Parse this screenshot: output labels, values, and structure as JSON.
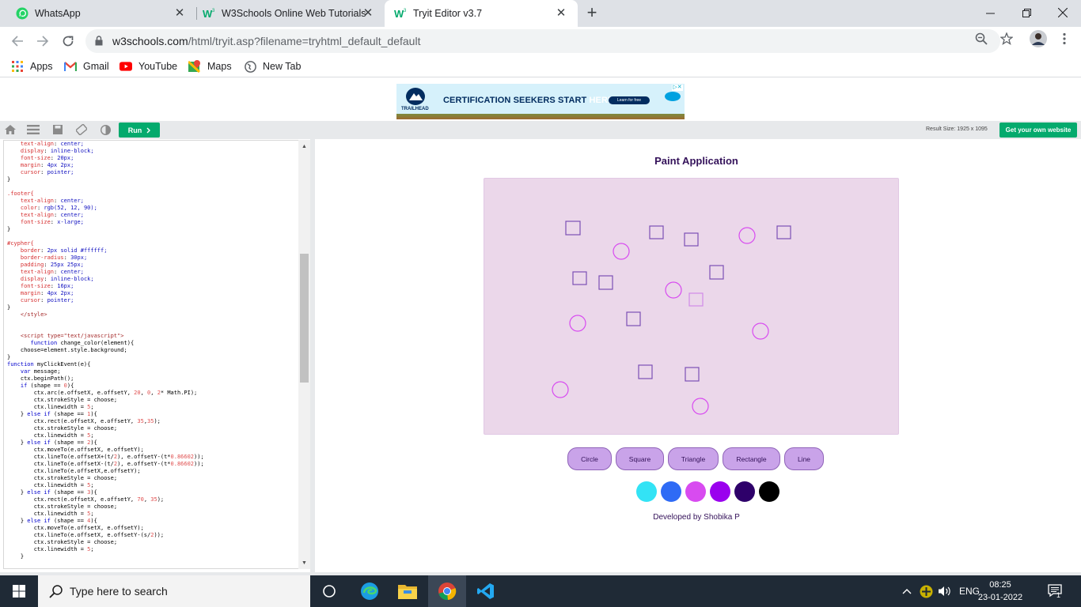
{
  "browser": {
    "tabs": [
      {
        "title": "WhatsApp",
        "icon": "whatsapp-icon",
        "active": false
      },
      {
        "title": "W3Schools Online Web Tutorials",
        "icon": "w3schools-icon",
        "active": false
      },
      {
        "title": "Tryit Editor v3.7",
        "icon": "w3schools-icon",
        "active": true
      }
    ],
    "url_host": "w3schools.com",
    "url_path": "/html/tryit.asp?filename=tryhtml_default_default",
    "bookmarks": [
      {
        "label": "Apps",
        "icon": "apps-grid-icon"
      },
      {
        "label": "Gmail",
        "icon": "gmail-icon"
      },
      {
        "label": "YouTube",
        "icon": "youtube-icon"
      },
      {
        "label": "Maps",
        "icon": "maps-icon"
      },
      {
        "label": "New Tab",
        "icon": "globe-icon"
      }
    ]
  },
  "ad": {
    "text_main": "CERTIFICATION SEEKERS START",
    "text_accent": "HERE.",
    "button": "Learn for free",
    "brand": "TRAILHEAD"
  },
  "tryit": {
    "run_label": "Run",
    "result_size": "Result Size: 1925 x 1095",
    "own_site_label": "Get your own website"
  },
  "code_lines": [
    {
      "pre": "    ",
      "prop": "text-align",
      "val": "center;"
    },
    {
      "pre": "    ",
      "prop": "display",
      "val": "inline-block;"
    },
    {
      "pre": "    ",
      "prop": "font-size",
      "val": "20px;"
    },
    {
      "pre": "    ",
      "prop": "margin",
      "val": "4px 2px;"
    },
    {
      "pre": "    ",
      "prop": "cursor",
      "val": "pointer;"
    },
    {
      "raw": "}"
    },
    {
      "raw": ""
    },
    {
      "sel": ".footer{"
    },
    {
      "pre": "    ",
      "prop": "text-align",
      "val": "center;"
    },
    {
      "pre": "    ",
      "prop": "color",
      "val": "rgb(52, 12, 90);"
    },
    {
      "pre": "    ",
      "prop": "text-align",
      "val": "center;"
    },
    {
      "pre": "    ",
      "prop": "font-size",
      "val": "x-large;"
    },
    {
      "raw": "}"
    },
    {
      "raw": ""
    },
    {
      "sel": "#cypher{"
    },
    {
      "pre": "    ",
      "prop": "border",
      "val": "2px solid #ffffff;"
    },
    {
      "pre": "    ",
      "prop": "border-radius",
      "val": "30px;"
    },
    {
      "pre": "    ",
      "prop": "padding",
      "val": "25px 25px;"
    },
    {
      "pre": "    ",
      "prop": "text-align",
      "val": "center;"
    },
    {
      "pre": "    ",
      "prop": "display",
      "val": "inline-block;"
    },
    {
      "pre": "    ",
      "prop": "font-size",
      "val": "16px;"
    },
    {
      "pre": "    ",
      "prop": "margin",
      "val": "4px 2px;"
    },
    {
      "pre": "    ",
      "prop": "cursor",
      "val": "pointer;"
    },
    {
      "raw": "}"
    },
    {
      "tag": "    </style>"
    },
    {
      "raw": ""
    },
    {
      "raw": ""
    },
    {
      "tag": "    <script type=\"text/javascript\">"
    },
    {
      "code": "       function change_color(element){"
    },
    {
      "code": "    choose=element.style.background;"
    },
    {
      "raw": "}"
    },
    {
      "code": "function myClickEvent(e){"
    },
    {
      "code": "    var message;"
    },
    {
      "code": "    ctx.beginPath();"
    },
    {
      "code": "    if (shape == 0){"
    },
    {
      "code": "        ctx.arc(e.offsetX, e.offsetY, 20, 0, 2* Math.PI);"
    },
    {
      "code": "        ctx.strokeStyle = choose;"
    },
    {
      "code": "        ctx.linewidth = 5;"
    },
    {
      "code": "    } else if (shape == 1){"
    },
    {
      "code": "        ctx.rect(e.offsetX, e.offsetY, 35,35);"
    },
    {
      "code": "        ctx.strokeStyle = choose;"
    },
    {
      "code": "        ctx.linewidth = 5;"
    },
    {
      "code": "    } else if (shape == 2){"
    },
    {
      "code": "        ctx.moveTo(e.offsetX, e.offsetY);"
    },
    {
      "code": "        ctx.lineTo(e.offsetX+(t/2), e.offsetY-(t*0.86602));"
    },
    {
      "code": "        ctx.lineTo(e.offsetX-(t/2), e.offsetY-(t*0.86602));"
    },
    {
      "code": "        ctx.lineTo(e.offsetX,e.offsetY);"
    },
    {
      "code": "        ctx.strokeStyle = choose;"
    },
    {
      "code": "        ctx.linewidth = 5;"
    },
    {
      "code": "    } else if (shape == 3){"
    },
    {
      "code": "        ctx.rect(e.offsetX, e.offsetY, 70, 35);"
    },
    {
      "code": "        ctx.strokeStyle = choose;"
    },
    {
      "code": "        ctx.linewidth = 5;"
    },
    {
      "code": "    } else if (shape == 4){"
    },
    {
      "code": "        ctx.moveTo(e.offsetX, e.offsetY);"
    },
    {
      "code": "        ctx.lineTo(e.offsetX, e.offsetY-(s/2));"
    },
    {
      "code": "        ctx.strokeStyle = choose;"
    },
    {
      "code": "        ctx.linewidth = 5;"
    },
    {
      "code": "    }"
    }
  ],
  "app": {
    "title": "Paint Application",
    "shape_buttons": [
      "Circle",
      "Square",
      "Triangle",
      "Rectangle",
      "Line"
    ],
    "colors": [
      "#33e3f5",
      "#2f6bf5",
      "#d84bf0",
      "#9a00ee",
      "#2e006a",
      "#000000"
    ],
    "footer": "Developed by Shobika P"
  },
  "taskbar": {
    "search_placeholder": "Type here to search",
    "apps": [
      "task-view-icon",
      "edge-icon",
      "file-explorer-icon",
      "chrome-icon",
      "vscode-icon"
    ],
    "language": "ENG",
    "time": "08:25",
    "date": "23-01-2022",
    "notification_count": "1"
  }
}
